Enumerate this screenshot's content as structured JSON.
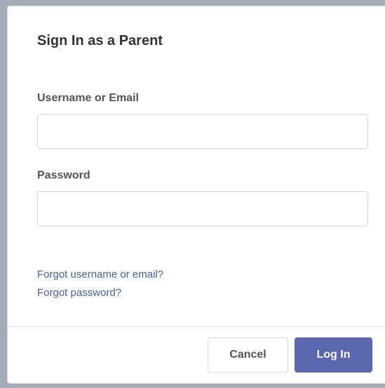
{
  "dialog": {
    "title": "Sign In as a Parent",
    "username_label": "Username or Email",
    "username_value": "",
    "password_label": "Password",
    "password_value": "",
    "forgot_username_link": "Forgot username or email?",
    "forgot_password_link": "Forgot password?",
    "cancel_label": "Cancel",
    "login_label": "Log In"
  },
  "colors": {
    "primary": "#5a66ad",
    "link": "#4a5fa0",
    "backdrop": "#a3acb6"
  }
}
